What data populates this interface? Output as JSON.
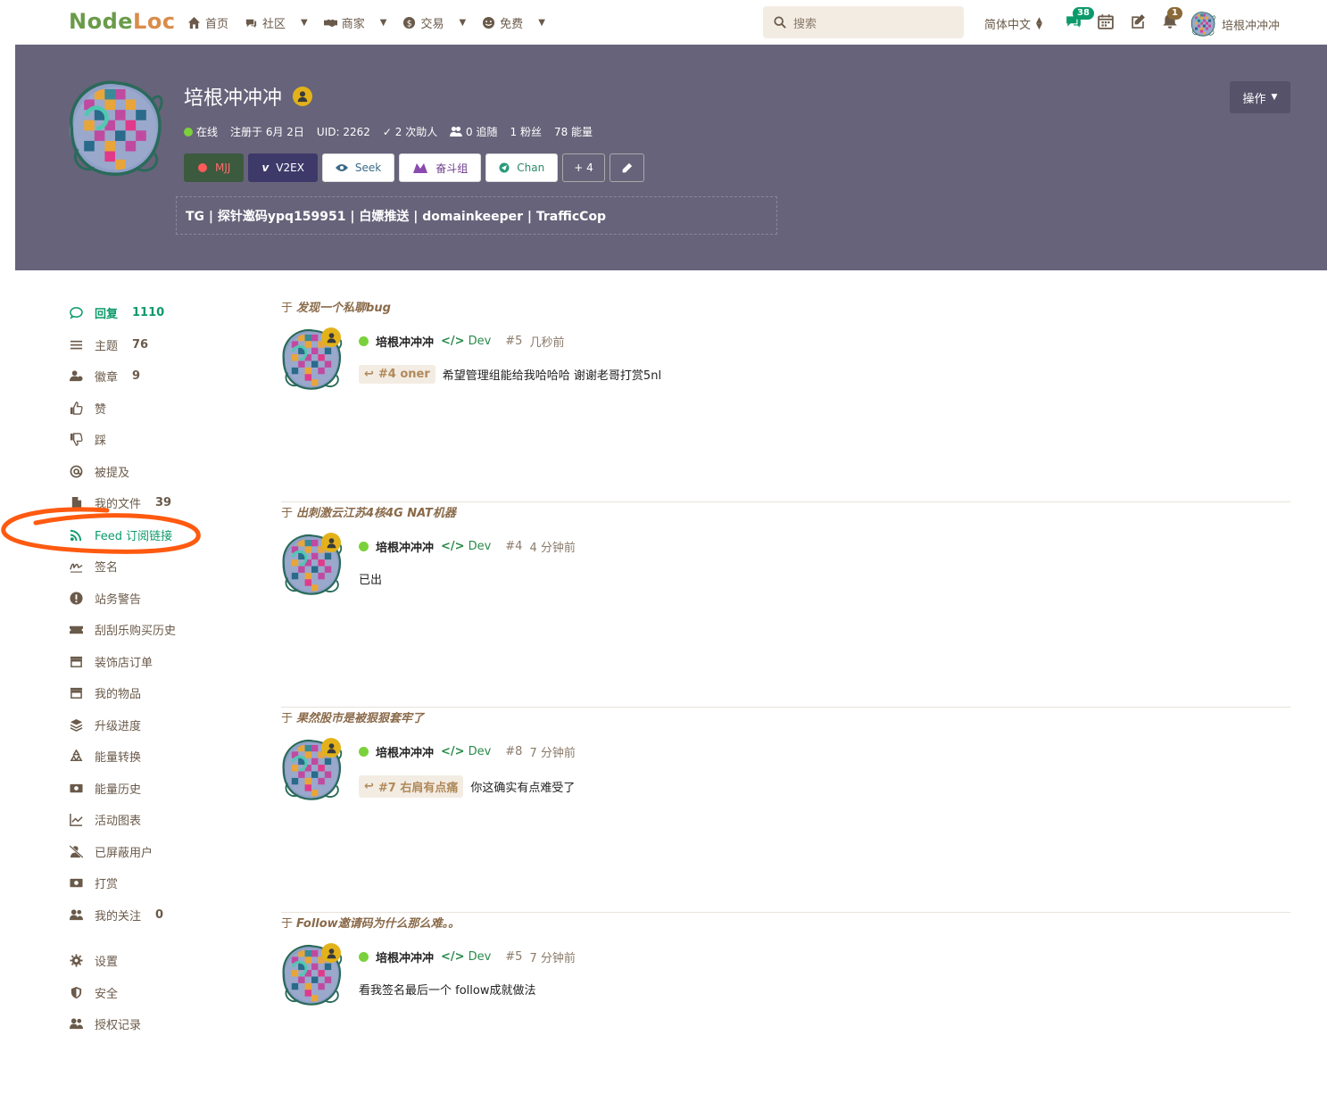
{
  "header": {
    "logo_part1": "Node",
    "logo_part2": "Loc",
    "nav": [
      {
        "label": "首页",
        "icon": "home-icon"
      },
      {
        "label": "社区",
        "icon": "community-icon"
      },
      {
        "label": "商家",
        "icon": "handshake-icon"
      },
      {
        "label": "交易",
        "icon": "trade-icon"
      },
      {
        "label": "免费",
        "icon": "smile-icon"
      }
    ],
    "search_placeholder": "搜索",
    "language": "简体中文",
    "messages_count": "38",
    "notifications_count": "1",
    "username": "培根冲冲冲"
  },
  "profile": {
    "name": "培根冲冲冲",
    "status": "在线",
    "registered": "注册于 6月 2日",
    "uid": "UID: 2262",
    "helped": "2 次助人",
    "following": "0 追随",
    "fans": "1 粉丝",
    "energy": "78 能量",
    "actions_label": "操作",
    "buttons": [
      {
        "label": "MJJ",
        "icon": "mjj-icon"
      },
      {
        "label": "V2EX",
        "icon": "v2ex-icon"
      },
      {
        "label": "Seek",
        "icon": "eye-icon"
      },
      {
        "label": "奋斗组",
        "icon": "group-icon"
      },
      {
        "label": "Chan",
        "icon": "chan-icon"
      },
      {
        "label": "+ 4",
        "icon": ""
      }
    ],
    "signature": "TG | 探针邀码ypq159951 | 白嫖推送 | domainkeeper | TrafficCop"
  },
  "sidebar": {
    "items": [
      {
        "label": "回复",
        "count": "1110",
        "icon": "comment-icon"
      },
      {
        "label": "主题",
        "count": "76",
        "icon": "list-icon"
      },
      {
        "label": "徽章",
        "count": "9",
        "icon": "user-badge-icon"
      },
      {
        "label": "赞",
        "count": "",
        "icon": "thumbs-up-icon"
      },
      {
        "label": "踩",
        "count": "",
        "icon": "thumbs-down-icon"
      },
      {
        "label": "被提及",
        "count": "",
        "icon": "at-icon"
      },
      {
        "label": "我的文件",
        "count": "39",
        "icon": "file-icon"
      },
      {
        "label": "Feed 订阅链接",
        "count": "",
        "icon": "rss-icon"
      },
      {
        "label": "签名",
        "count": "",
        "icon": "signature-icon"
      },
      {
        "label": "站务警告",
        "count": "",
        "icon": "warning-icon"
      },
      {
        "label": "刮刮乐购买历史",
        "count": "",
        "icon": "ticket-icon"
      },
      {
        "label": "装饰店订单",
        "count": "",
        "icon": "store-icon"
      },
      {
        "label": "我的物品",
        "count": "",
        "icon": "store-icon"
      },
      {
        "label": "升级进度",
        "count": "",
        "icon": "layers-icon"
      },
      {
        "label": "能量转换",
        "count": "",
        "icon": "recycle-icon"
      },
      {
        "label": "能量历史",
        "count": "",
        "icon": "money-icon"
      },
      {
        "label": "活动图表",
        "count": "",
        "icon": "chart-icon"
      },
      {
        "label": "已屏蔽用户",
        "count": "",
        "icon": "user-slash-icon"
      },
      {
        "label": "打赏",
        "count": "",
        "icon": "money-icon"
      },
      {
        "label": "我的关注",
        "count": "0",
        "icon": "users-icon"
      }
    ],
    "settings": [
      {
        "label": "设置",
        "icon": "gear-icon"
      },
      {
        "label": "安全",
        "icon": "shield-icon"
      },
      {
        "label": "授权记录",
        "icon": "users-icon"
      }
    ]
  },
  "posts": [
    {
      "prefix": "于",
      "title": "发现一个私聊bug",
      "user": "培根冲冲冲",
      "role": "Dev",
      "num": "#5",
      "time": "几秒前",
      "reply_to": "#4 oner",
      "body": "希望管理组能给我哈哈哈 谢谢老哥打赏5nl"
    },
    {
      "prefix": "于",
      "title": "出刺激云江苏4核4G NAT机器",
      "user": "培根冲冲冲",
      "role": "Dev",
      "num": "#4",
      "time": "4 分钟前",
      "reply_to": "",
      "body": "已出"
    },
    {
      "prefix": "于",
      "title": "果然股市是被狠狠套牢了",
      "user": "培根冲冲冲",
      "role": "Dev",
      "num": "#8",
      "time": "7 分钟前",
      "reply_to": "#7 右肩有点痛",
      "body": "你这确实有点难受了"
    },
    {
      "prefix": "于",
      "title": "Follow邀请码为什么那么难。。",
      "user": "培根冲冲冲",
      "role": "Dev",
      "num": "#5",
      "time": "7 分钟前",
      "reply_to": "",
      "body": "看我签名最后一个 follow成就做法"
    }
  ]
}
